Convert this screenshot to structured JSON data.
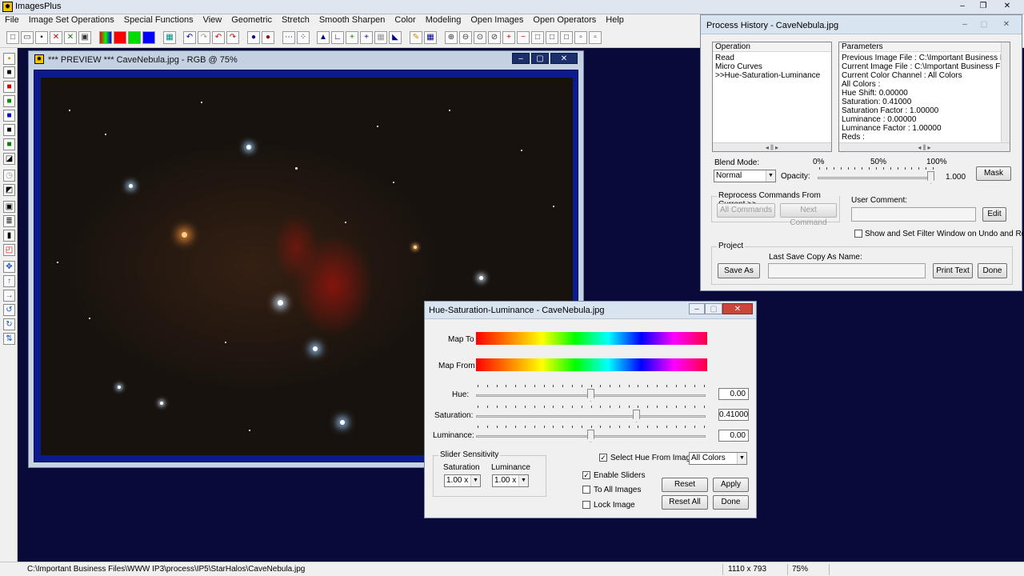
{
  "app": {
    "title": "ImagesPlus",
    "controls": [
      "–",
      "❐",
      "✕"
    ]
  },
  "menu": [
    "File",
    "Image Set Operations",
    "Special Functions",
    "View",
    "Geometric",
    "Stretch",
    "Smooth Sharpen",
    "Color",
    "Modeling",
    "Open Images",
    "Open Operators",
    "Help"
  ],
  "preview_window": {
    "title": "*** PREVIEW *** CaveNebula.jpg - RGB @ 75%",
    "controls": [
      "–",
      "▢",
      "✕"
    ]
  },
  "process_history": {
    "title": "Process History - CaveNebula.jpg",
    "operation_header": "Operation",
    "operations": [
      "Read",
      "Micro Curves",
      ">>Hue-Saturation-Luminance"
    ],
    "parameters_header": "Parameters",
    "parameters": [
      "Previous Image File : C:\\Important Business Files\\W",
      "Current Image File : C:\\Important Business Files\\W\\",
      "Current Color Channel : All Colors",
      "All Colors :",
      "Hue Shift: 0.00000",
      "Saturation: 0.41000",
      "Saturation Factor : 1.00000",
      "Luminance : 0.00000",
      "Luminance Factor : 1.00000",
      "Reds :"
    ],
    "blend_mode_label": "Blend Mode:",
    "blend_mode_value": "Normal",
    "opacity_label": "Opacity:",
    "opacity_ticks": [
      "0%",
      "50%",
      "100%"
    ],
    "opacity_value": "1.000",
    "opacity_fraction": 1.0,
    "mask_button": "Mask",
    "reprocess_legend": "Reprocess Commands From Current >>",
    "all_commands_button": "All Commands",
    "next_command_button": "Next Command",
    "user_comment_label": "User Comment:",
    "edit_button": "Edit",
    "show_filter_label": "Show and Set Filter Window on Undo and Redo",
    "project_legend": "Project",
    "last_save_label": "Last Save Copy As Name:",
    "save_as_button": "Save As",
    "print_text_button": "Print Text",
    "done_button": "Done"
  },
  "hsl_window": {
    "title": "Hue-Saturation-Luminance - CaveNebula.jpg",
    "map_to_label": "Map To",
    "map_from_label": "Map From",
    "hue_label": "Hue:",
    "hue_value": "0.00",
    "hue_fraction": 0.5,
    "saturation_label": "Saturation:",
    "saturation_value": "0.41000",
    "saturation_fraction": 0.705,
    "luminance_label": "Luminance:",
    "luminance_value": "0.00",
    "luminance_fraction": 0.5,
    "slider_sensitivity_legend": "Slider Sensitivity",
    "sens_saturation_label": "Saturation",
    "sens_luminance_label": "Luminance",
    "sens_saturation_value": "1.00 x",
    "sens_luminance_value": "1.00 x",
    "select_hue_label": "Select Hue From Image",
    "color_select_value": "All Colors",
    "enable_sliders_label": "Enable Sliders",
    "to_all_images_label": "To All Images",
    "lock_image_label": "Lock Image",
    "reset_button": "Reset",
    "apply_button": "Apply",
    "reset_all_button": "Reset All",
    "done_button": "Done"
  },
  "status": {
    "path": "C:\\Important Business Files\\WWW IP3\\process\\IP5\\StarHalos\\CaveNebula.jpg",
    "dimensions": "1110 x 793",
    "zoom": "75%"
  },
  "colors": {
    "desktop": "#0a0a3a",
    "window_title": "#d9e4f1",
    "preview_frame": "#0b1a8c"
  }
}
